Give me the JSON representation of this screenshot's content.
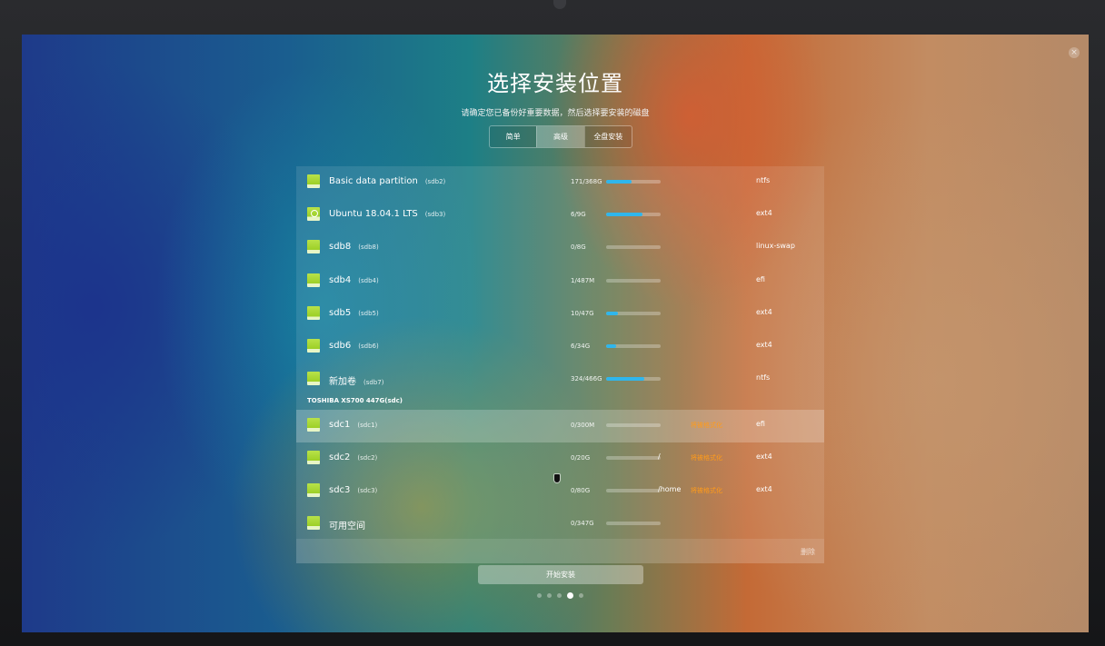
{
  "installer": {
    "title": "选择安装位置",
    "subtitle": "请确定您已备份好重要数据，然后选择要安装的磁盘",
    "close_symbol": "×"
  },
  "mode_tabs": [
    {
      "label": "简单",
      "active": false
    },
    {
      "label": "高级",
      "active": true
    },
    {
      "label": "全盘安装",
      "active": false
    }
  ],
  "partitions": [
    {
      "name": "Basic data partition",
      "dev": "(sdb2)",
      "usage": "171/368G",
      "used_fraction": 0.46,
      "mount": "",
      "format_label": "",
      "fs": "ntfs",
      "icon": "disk-icon"
    },
    {
      "name": "Ubuntu 18.04.1 LTS",
      "dev": "(sdb3)",
      "usage": "6/9G",
      "used_fraction": 0.67,
      "mount": "",
      "format_label": "",
      "fs": "ext4",
      "icon": "ubuntu-disk-icon"
    },
    {
      "name": "sdb8",
      "dev": "(sdb8)",
      "usage": "0/8G",
      "used_fraction": 0.0,
      "mount": "",
      "format_label": "",
      "fs": "linux-swap",
      "icon": "disk-icon"
    },
    {
      "name": "sdb4",
      "dev": "(sdb4)",
      "usage": "1/487M",
      "used_fraction": 0.0,
      "mount": "",
      "format_label": "",
      "fs": "efi",
      "icon": "disk-icon"
    },
    {
      "name": "sdb5",
      "dev": "(sdb5)",
      "usage": "10/47G",
      "used_fraction": 0.21,
      "mount": "",
      "format_label": "",
      "fs": "ext4",
      "icon": "disk-icon"
    },
    {
      "name": "sdb6",
      "dev": "(sdb6)",
      "usage": "6/34G",
      "used_fraction": 0.18,
      "mount": "",
      "format_label": "",
      "fs": "ext4",
      "icon": "disk-icon"
    },
    {
      "name": "新加卷",
      "dev": "(sdb7)",
      "usage": "324/466G",
      "used_fraction": 0.7,
      "mount": "",
      "format_label": "",
      "fs": "ntfs",
      "icon": "disk-icon"
    }
  ],
  "disk_header": "TOSHIBA XS700 447G(sdc)",
  "partitions2": [
    {
      "name": "sdc1",
      "dev": "(sdc1)",
      "usage": "0/300M",
      "used_fraction": 0.0,
      "mount": "",
      "format_label": "将被格式化",
      "fs": "efi",
      "icon": "disk-icon",
      "selected": true
    },
    {
      "name": "sdc2",
      "dev": "(sdc2)",
      "usage": "0/20G",
      "used_fraction": 0.0,
      "mount": "/",
      "format_label": "将被格式化",
      "fs": "ext4",
      "icon": "disk-icon"
    },
    {
      "name": "sdc3",
      "dev": "(sdc3)",
      "usage": "0/80G",
      "used_fraction": 0.0,
      "mount": "/home",
      "format_label": "将被格式化",
      "fs": "ext4",
      "icon": "disk-icon"
    },
    {
      "name": "可用空间",
      "dev": "",
      "usage": "0/347G",
      "used_fraction": 0.0,
      "mount": "",
      "format_label": "",
      "fs": "",
      "icon": "disk-icon"
    }
  ],
  "footer": {
    "delete_label": "删除"
  },
  "install_button": {
    "label": "开始安装"
  },
  "page_dots": {
    "count": 5,
    "active_index": 3
  },
  "colors": {
    "accent_bar": "#2fb6ec",
    "format_warning": "#ff9b1a",
    "disk_icon": "#9ccf25"
  }
}
